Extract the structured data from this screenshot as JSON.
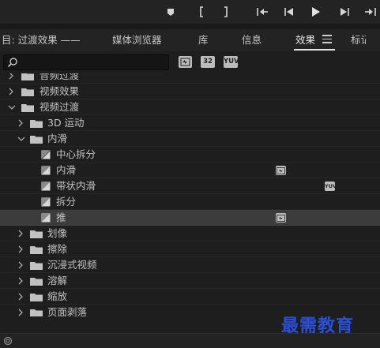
{
  "transport": {
    "buttons": [
      {
        "name": "add-marker",
        "glyph": "marker"
      },
      {
        "name": "mark-in",
        "glyph": "mark-in"
      },
      {
        "name": "mark-out",
        "glyph": "mark-out"
      },
      {
        "name": "go-to-in",
        "glyph": "go-to-in"
      },
      {
        "name": "step-back",
        "glyph": "step-back"
      },
      {
        "name": "play",
        "glyph": "play"
      },
      {
        "name": "step-forward",
        "glyph": "step-forward"
      },
      {
        "name": "go-to-out",
        "glyph": "go-to-out"
      }
    ]
  },
  "tabs": {
    "source_partial": "目: 过渡效果 ——",
    "media_browser": "媒体浏览器",
    "library": "库",
    "info": "信息",
    "effects": "效果",
    "markers_partial": "标记"
  },
  "toolbar": {
    "search_value": "",
    "badges": [
      "accelerated-icon",
      "32",
      "YUV"
    ]
  },
  "tree": {
    "rows": [
      {
        "label": "音频过渡",
        "type": "folder",
        "expanded": false,
        "level": 0
      },
      {
        "label": "视频效果",
        "type": "folder",
        "expanded": false,
        "level": 0
      },
      {
        "label": "视频过渡",
        "type": "folder",
        "expanded": true,
        "level": 0
      },
      {
        "label": "3D 运动",
        "type": "folder",
        "expanded": false,
        "level": 1
      },
      {
        "label": "内滑",
        "type": "folder",
        "expanded": true,
        "level": 1
      },
      {
        "label": "中心拆分",
        "type": "preset",
        "level": 2,
        "badge": ""
      },
      {
        "label": "内滑",
        "type": "preset",
        "level": 2,
        "badge": "accelerated"
      },
      {
        "label": "带状内滑",
        "type": "preset",
        "level": 2,
        "badge": "yuv"
      },
      {
        "label": "拆分",
        "type": "preset",
        "level": 2,
        "badge": ""
      },
      {
        "label": "推",
        "type": "preset",
        "level": 2,
        "badge": "accelerated",
        "selected": true
      },
      {
        "label": "划像",
        "type": "folder",
        "expanded": false,
        "level": 1
      },
      {
        "label": "擦除",
        "type": "folder",
        "expanded": false,
        "level": 1
      },
      {
        "label": "沉浸式视频",
        "type": "folder",
        "expanded": false,
        "level": 1
      },
      {
        "label": "溶解",
        "type": "folder",
        "expanded": false,
        "level": 1
      },
      {
        "label": "缩放",
        "type": "folder",
        "expanded": false,
        "level": 1
      },
      {
        "label": "页面剥落",
        "type": "folder",
        "expanded": false,
        "level": 1
      }
    ]
  },
  "watermark": "最需教育",
  "colors": {
    "panel_bg": "#1e1e1e",
    "selected_row": "#3c3c3c",
    "watermark": "#2b4fd6"
  }
}
